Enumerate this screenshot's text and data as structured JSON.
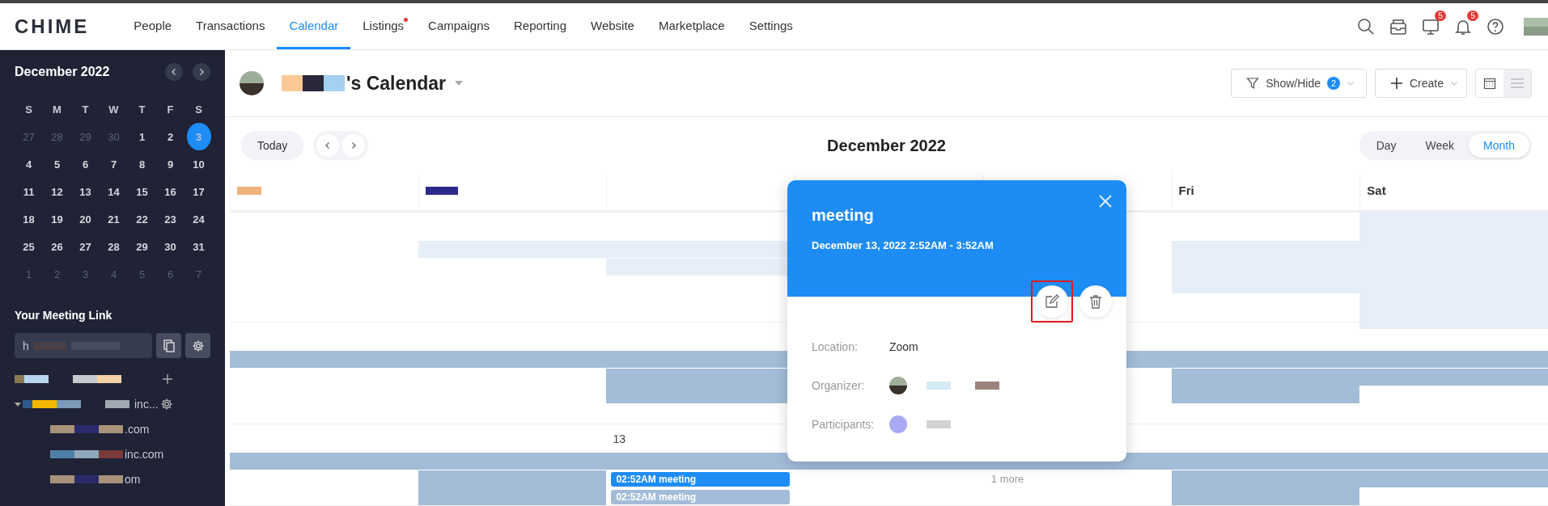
{
  "nav": {
    "logo": "CHIME",
    "items": [
      {
        "label": "People",
        "selected": false,
        "dot": false
      },
      {
        "label": "Transactions",
        "selected": false,
        "dot": false
      },
      {
        "label": "Calendar",
        "selected": true,
        "dot": false
      },
      {
        "label": "Listings",
        "selected": false,
        "dot": true
      },
      {
        "label": "Campaigns",
        "selected": false,
        "dot": false
      },
      {
        "label": "Reporting",
        "selected": false,
        "dot": false
      },
      {
        "label": "Website",
        "selected": false,
        "dot": false
      },
      {
        "label": "Marketplace",
        "selected": false,
        "dot": false
      },
      {
        "label": "Settings",
        "selected": false,
        "dot": false
      }
    ],
    "icons": [
      {
        "kind": "search"
      },
      {
        "kind": "inbox"
      },
      {
        "kind": "monitor",
        "badge": "5"
      },
      {
        "kind": "bell",
        "badge": "5"
      },
      {
        "kind": "help"
      }
    ]
  },
  "sidebar": {
    "month": "December 2022",
    "weekdays": [
      "S",
      "M",
      "T",
      "W",
      "T",
      "F",
      "S"
    ],
    "days": [
      {
        "label": "27",
        "muted": true,
        "selected": false
      },
      {
        "label": "28",
        "muted": true,
        "selected": false
      },
      {
        "label": "29",
        "muted": true,
        "selected": false
      },
      {
        "label": "30",
        "muted": true,
        "selected": false
      },
      {
        "label": "1",
        "muted": false,
        "selected": false
      },
      {
        "label": "2",
        "muted": false,
        "selected": false
      },
      {
        "label": "3",
        "muted": false,
        "selected": true
      },
      {
        "label": "4",
        "muted": false,
        "selected": false
      },
      {
        "label": "5",
        "muted": false,
        "selected": false
      },
      {
        "label": "6",
        "muted": false,
        "selected": false
      },
      {
        "label": "7",
        "muted": false,
        "selected": false
      },
      {
        "label": "8",
        "muted": false,
        "selected": false
      },
      {
        "label": "9",
        "muted": false,
        "selected": false
      },
      {
        "label": "10",
        "muted": false,
        "selected": false
      },
      {
        "label": "11",
        "muted": false,
        "selected": false
      },
      {
        "label": "12",
        "muted": false,
        "selected": false
      },
      {
        "label": "13",
        "muted": false,
        "selected": false
      },
      {
        "label": "14",
        "muted": false,
        "selected": false
      },
      {
        "label": "15",
        "muted": false,
        "selected": false
      },
      {
        "label": "16",
        "muted": false,
        "selected": false
      },
      {
        "label": "17",
        "muted": false,
        "selected": false
      },
      {
        "label": "18",
        "muted": false,
        "selected": false
      },
      {
        "label": "19",
        "muted": false,
        "selected": false
      },
      {
        "label": "20",
        "muted": false,
        "selected": false
      },
      {
        "label": "21",
        "muted": false,
        "selected": false
      },
      {
        "label": "22",
        "muted": false,
        "selected": false
      },
      {
        "label": "23",
        "muted": false,
        "selected": false
      },
      {
        "label": "24",
        "muted": false,
        "selected": false
      },
      {
        "label": "25",
        "muted": false,
        "selected": false
      },
      {
        "label": "26",
        "muted": false,
        "selected": false
      },
      {
        "label": "27",
        "muted": false,
        "selected": false
      },
      {
        "label": "28",
        "muted": false,
        "selected": false
      },
      {
        "label": "29",
        "muted": false,
        "selected": false
      },
      {
        "label": "30",
        "muted": false,
        "selected": false
      },
      {
        "label": "31",
        "muted": false,
        "selected": false
      },
      {
        "label": "1",
        "muted": true,
        "selected": false
      },
      {
        "label": "2",
        "muted": true,
        "selected": false
      },
      {
        "label": "3",
        "muted": true,
        "selected": false
      },
      {
        "label": "4",
        "muted": true,
        "selected": false
      },
      {
        "label": "5",
        "muted": true,
        "selected": false
      },
      {
        "label": "6",
        "muted": true,
        "selected": false
      },
      {
        "label": "7",
        "muted": true,
        "selected": false
      }
    ],
    "meeting_link": {
      "title": "Your Meeting Link",
      "value": "h"
    },
    "tree": [
      {
        "text": "inc...",
        "expanded": true,
        "children": [
          {
            "text": ".com"
          },
          {
            "text": "inc.com"
          },
          {
            "text": "om"
          }
        ]
      }
    ]
  },
  "header": {
    "title_suffix": "'s Calendar",
    "show_hide": {
      "label": "Show/Hide",
      "count": "2"
    },
    "create": "Create",
    "views": [
      {
        "kind": "grid",
        "selected": true
      },
      {
        "kind": "list",
        "selected": false
      }
    ]
  },
  "toolbar": {
    "today": "Today",
    "period": "December 2022",
    "ranges": [
      {
        "label": "Day",
        "selected": false
      },
      {
        "label": "Week",
        "selected": false
      },
      {
        "label": "Month",
        "selected": true
      }
    ]
  },
  "grid": {
    "headers": [
      "Fri",
      "Sat"
    ],
    "day_number": "13",
    "events": [
      {
        "label": "02:52AM meeting",
        "selected": true
      },
      {
        "label": "02:52AM meeting",
        "selected": false
      }
    ],
    "more": "1 more"
  },
  "popup": {
    "title": "meeting",
    "time": "December 13, 2022 2:52AM - 3:52AM",
    "edit_highlighted": true,
    "fields": [
      {
        "label": "Location:",
        "kind": "text",
        "value": "Zoom"
      },
      {
        "label": "Organizer:",
        "kind": "person"
      },
      {
        "label": "Participants:",
        "kind": "person"
      }
    ]
  }
}
